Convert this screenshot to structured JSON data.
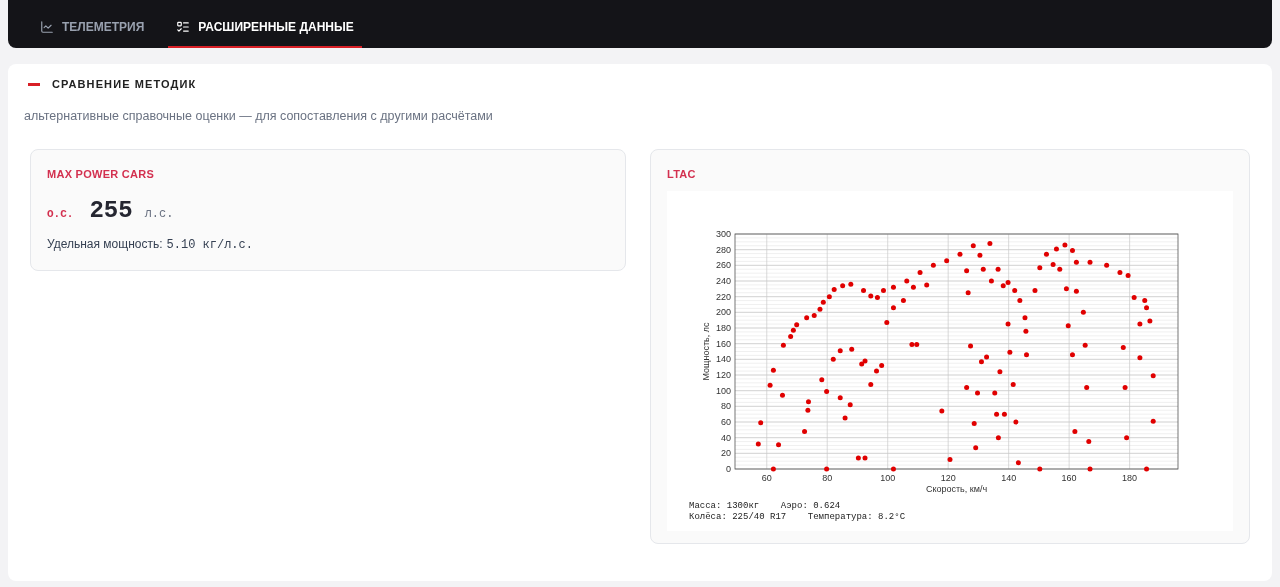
{
  "tabs": [
    {
      "label": "ТЕЛЕМЕТРИЯ",
      "selected": false
    },
    {
      "label": "РАСШИРЕННЫЕ ДАННЫЕ",
      "selected": true
    }
  ],
  "section": {
    "title": "СРАВНЕНИЕ МЕТОДИК",
    "subtitle": "альтернативные справочные оценки — для сопоставления с другими расчётами"
  },
  "cards": [
    {
      "kind": "metric",
      "title": "MAX POWER CARS",
      "prefix": "О.С.",
      "value": "255",
      "unit": "л.с.",
      "specific_label": "Удельная мощность:",
      "specific_value": "5.10 кг/л.с."
    },
    {
      "kind": "chart",
      "title": "LTAC",
      "notes": [
        "Масса: 1300кг    Аэро: 0.624",
        "Колёса: 225/40 R17    Температура: 8.2°C"
      ],
      "chart_data": {
        "type": "scatter",
        "grid": true,
        "xlabel": "Скорость, км/ч",
        "ylabel": "Мощность, лс",
        "xlim": [
          49.5,
          196
        ],
        "ylim": [
          0,
          300
        ],
        "xticks": [
          60,
          80,
          100,
          120,
          140,
          160,
          180
        ],
        "yticks": [
          0,
          20,
          40,
          60,
          80,
          100,
          120,
          140,
          160,
          180,
          200,
          220,
          240,
          260,
          280,
          300
        ],
        "x": [
          57.2,
          58,
          61.1,
          62.2,
          65.5,
          67.9,
          68.8,
          69.9,
          73.2,
          75.7,
          65.2,
          63.9,
          72.5,
          73.6,
          73.8,
          82.3,
          85.1,
          87.8,
          92,
          94.4,
          78.7,
          77.6,
          80.7,
          84.3,
          88.1,
          82,
          78.2,
          79.8,
          84.3,
          85.9,
          87.6,
          91.4,
          92.5,
          94.4,
          96.3,
          98,
          99.7,
          101.9,
          96.6,
          98.6,
          101.9,
          106.3,
          110.7,
          115.1,
          119.5,
          108.5,
          112.9,
          105.2,
          90.3,
          92.5,
          117.9,
          108,
          109.6,
          128.3,
          133.8,
          123.9,
          130.5,
          126.1,
          131.6,
          136.5,
          139.8,
          142,
          143.7,
          145.4,
          145.7,
          145.9,
          148.7,
          150.3,
          152.5,
          155.8,
          158.6,
          161.1,
          162.4,
          156.9,
          154.7,
          166.9,
          172.4,
          176.8,
          179.5,
          159.1,
          162.4,
          181.5,
          183.4,
          185,
          185.6,
          186.7,
          183.4,
          187.8,
          187.8,
          177.9,
          178.5,
          179,
          164.7,
          165.3,
          165.8,
          161.9,
          166.5,
          159.7,
          161.1,
          132.7,
          131,
          129.7,
          128.6,
          129.1,
          137.1,
          138.6,
          136,
          136.6,
          140.4,
          141.5,
          142.4,
          135.4,
          139.8,
          143.2,
          150.3,
          166.9,
          185.6,
          120.6,
          126.1,
          127.4,
          126.6,
          138.2,
          134.3,
          62.2,
          79.8,
          101.9
        ],
        "series": [
          {
            "color": "#e00000",
            "values": [
              32,
              59,
              107,
              126,
              158,
              169,
              177,
              184,
              193,
              196,
              94,
              31,
              48,
              75,
              86,
              229,
              234,
              236,
              228,
              221,
              213,
              204,
              220,
              151,
              153,
              140,
              114,
              99,
              91,
              65,
              82,
              134,
              138,
              108,
              125,
              132,
              187,
              206,
              219,
              228,
              232,
              240,
              251,
              260,
              266,
              232,
              235,
              215,
              14,
              14,
              74,
              159,
              159,
              285,
              288,
              274,
              273,
              253,
              255,
              255,
              238,
              228,
              215,
              193,
              176,
              146,
              228,
              257,
              274,
              281,
              286,
              279,
              264,
              255,
              261,
              264,
              260,
              251,
              247,
              230,
              227,
              219,
              185,
              215,
              206,
              189,
              142,
              119,
              61,
              155,
              104,
              40,
              200,
              158,
              104,
              48,
              35,
              183,
              146,
              143,
              137,
              97,
              58,
              27,
              124,
              70,
              70,
              40,
              149,
              108,
              60,
              97,
              185,
              8,
              0,
              0,
              0,
              12,
              104,
              157,
              225,
              234,
              240,
              0,
              0,
              0
            ]
          }
        ]
      }
    }
  ]
}
